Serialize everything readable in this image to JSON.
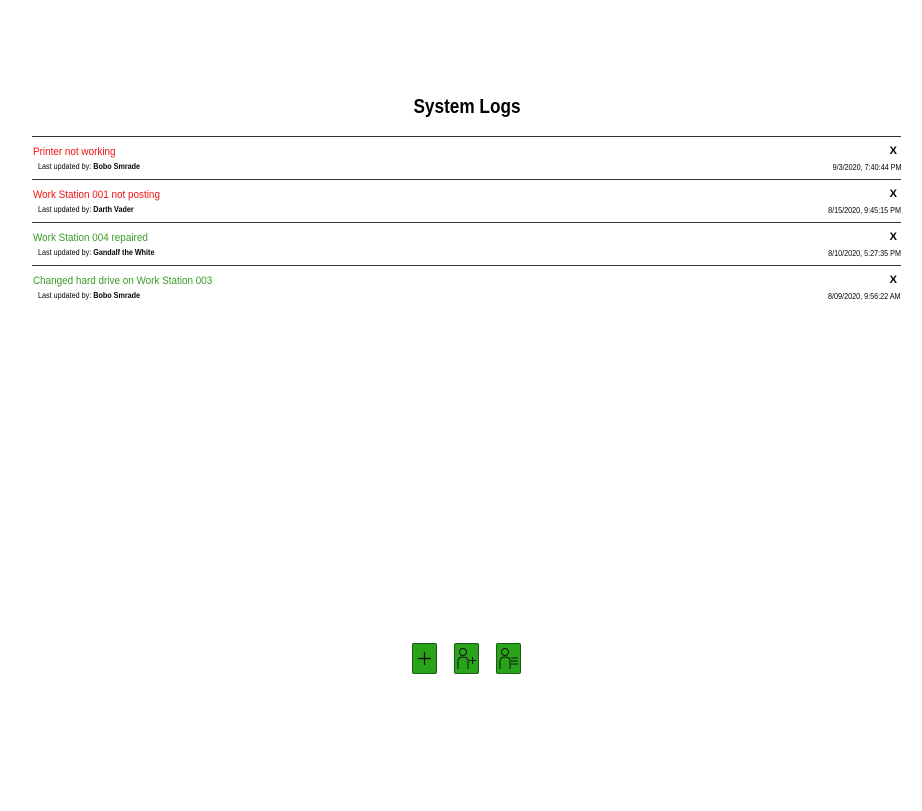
{
  "page": {
    "title": "System Logs"
  },
  "colors": {
    "open_status": "#ee1111",
    "resolved_status": "#3a9a26",
    "button_green": "#29a319"
  },
  "logs": [
    {
      "title": "Printer not working",
      "status": "open",
      "updated_prefix": "Last updated by: ",
      "user": "Bobo Smrade",
      "timestamp": "9/3/2020, 7:40:44 PM",
      "delete_label": "X"
    },
    {
      "title": "Work Station 001 not posting",
      "status": "open",
      "updated_prefix": "Last updated by: ",
      "user": "Darth Vader",
      "timestamp": "8/15/2020, 9:45:15 PM",
      "delete_label": "X"
    },
    {
      "title": "Work Station 004 repaired",
      "status": "resolved",
      "updated_prefix": "Last updated by: ",
      "user": "Gandalf the White",
      "timestamp": "8/10/2020, 5:27:35 PM",
      "delete_label": "X"
    },
    {
      "title": "Changed hard drive on Work Station 003",
      "status": "resolved",
      "updated_prefix": "Last updated by: ",
      "user": "Bobo Smrade",
      "timestamp": "8/09/2020, 9:56:22 AM",
      "delete_label": "X"
    }
  ],
  "toolbar": {
    "buttons": [
      {
        "icon": "plus-icon"
      },
      {
        "icon": "add-user-icon"
      },
      {
        "icon": "user-list-icon"
      }
    ]
  }
}
